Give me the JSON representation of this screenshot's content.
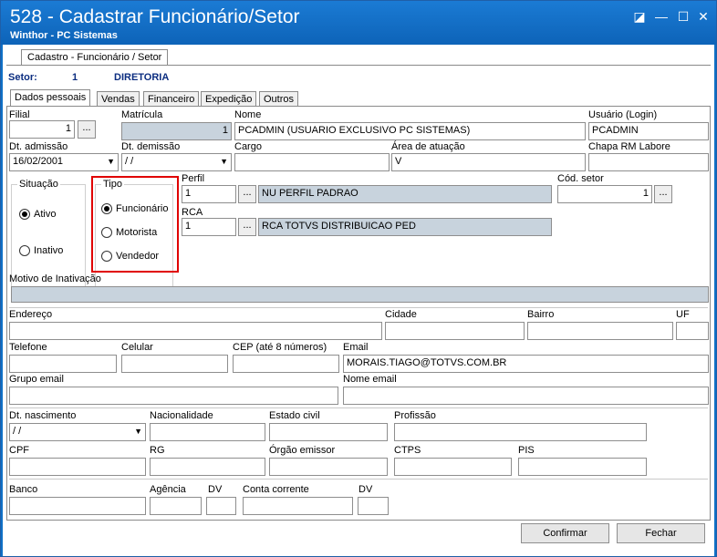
{
  "window": {
    "title": "528 - Cadastrar Funcionário/Setor",
    "subtitle": "Winthor - PC Sistemas"
  },
  "outer_tab": "Cadastro - Funcionário / Setor",
  "setor": {
    "label": "Setor:",
    "code": "1",
    "name": "DIRETORIA"
  },
  "tabs": [
    "Dados pessoais",
    "Vendas",
    "Financeiro",
    "Expedição",
    "Outros"
  ],
  "fields": {
    "filial": {
      "label": "Filial",
      "value": "1"
    },
    "matricula": {
      "label": "Matrícula",
      "value": "1"
    },
    "nome": {
      "label": "Nome",
      "value": "PCADMIN (USUARIO EXCLUSIVO PC SISTEMAS)"
    },
    "usuario": {
      "label": "Usuário (Login)",
      "value": "PCADMIN"
    },
    "dt_admissao": {
      "label": "Dt. admissão",
      "value": "16/02/2001"
    },
    "dt_demissao": {
      "label": "Dt.  demissão",
      "value": " /  /"
    },
    "cargo": {
      "label": "Cargo",
      "value": ""
    },
    "area_atuacao": {
      "label": "Área de atuação",
      "value": "V"
    },
    "chapa": {
      "label": "Chapa RM Labore",
      "value": ""
    },
    "perfil": {
      "label": "Perfil",
      "code": "1",
      "desc": "NU  PERFIL PADRAO"
    },
    "rca": {
      "label": "RCA",
      "code": "1",
      "desc": "RCA TOTVS DISTRIBUICAO PED"
    },
    "cod_setor": {
      "label": "Cód. setor",
      "value": "1"
    },
    "motivo_inativacao": {
      "label": "Motivo de Inativação",
      "value": ""
    },
    "endereco": {
      "label": "Endereço"
    },
    "cidade": {
      "label": "Cidade"
    },
    "bairro": {
      "label": "Bairro"
    },
    "uf": {
      "label": "UF"
    },
    "telefone": {
      "label": "Telefone"
    },
    "celular": {
      "label": "Celular"
    },
    "cep": {
      "label": "CEP (até 8 números)"
    },
    "email": {
      "label": "Email",
      "value": "MORAIS.TIAGO@TOTVS.COM.BR"
    },
    "grupo_email": {
      "label": "Grupo email"
    },
    "nome_email": {
      "label": "Nome email"
    },
    "dt_nascimento": {
      "label": "Dt. nascimento",
      "value": " /  /"
    },
    "nacionalidade": {
      "label": "Nacionalidade"
    },
    "estado_civil": {
      "label": "Estado civil"
    },
    "profissao": {
      "label": "Profissão"
    },
    "cpf": {
      "label": "CPF"
    },
    "rg": {
      "label": "RG"
    },
    "orgao_emissor": {
      "label": "Órgão emissor"
    },
    "ctps": {
      "label": "CTPS"
    },
    "pis": {
      "label": "PIS"
    },
    "banco": {
      "label": "Banco"
    },
    "agencia": {
      "label": "Agência"
    },
    "dv1": {
      "label": "DV"
    },
    "conta_corrente": {
      "label": "Conta corrente"
    },
    "dv2": {
      "label": "DV"
    }
  },
  "situacao": {
    "title": "Situação",
    "options": [
      "Ativo",
      "Inativo"
    ],
    "selected": "Ativo"
  },
  "tipo": {
    "title": "Tipo",
    "options": [
      "Funcionário",
      "Motorista",
      "Vendedor"
    ],
    "selected": "Funcionário"
  },
  "buttons": {
    "dots": "...",
    "confirmar": "Confirmar",
    "fechar": "Fechar"
  },
  "colors": {
    "titlebar": "#0f70c6",
    "highlight": "#e00000",
    "readonly_fill": "#c8d3dd"
  }
}
